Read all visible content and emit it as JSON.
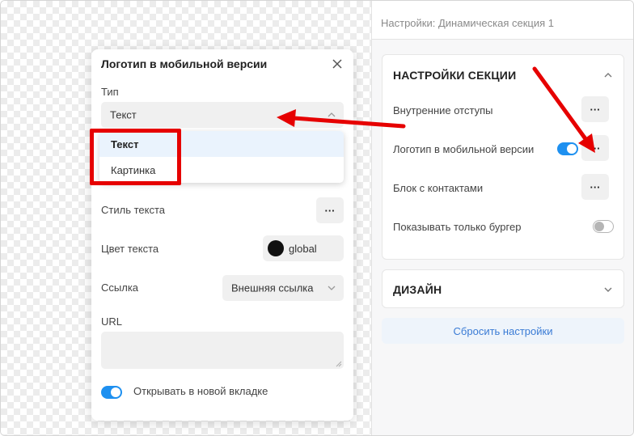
{
  "right_panel": {
    "header": "Настройки: Динамическая секция 1",
    "section_card": {
      "title": "НАСТРОЙКИ СЕКЦИИ",
      "rows": [
        {
          "label": "Внутренние отступы",
          "control": "more",
          "more_label": "···"
        },
        {
          "label": "Логотип в мобильной версии",
          "control": "toggle-more",
          "toggle": "on",
          "more_label": "···"
        },
        {
          "label": "Блок с контактами",
          "control": "more",
          "more_label": "···"
        },
        {
          "label": "Показывать только бургер",
          "control": "toggle",
          "toggle": "off"
        }
      ]
    },
    "design_card": {
      "title": "ДИЗАЙН"
    },
    "reset_button": "Сбросить настройки"
  },
  "modal": {
    "title": "Логотип в мобильной версии",
    "type_label": "Тип",
    "type_value": "Текст",
    "type_options": [
      {
        "label": "Текст",
        "selected": true
      },
      {
        "label": "Картинка",
        "selected": false
      }
    ],
    "text_style_label": "Стиль текста",
    "text_style_more": "···",
    "text_color_label": "Цвет текста",
    "text_color_value": "global",
    "text_color_swatch": "#111111",
    "link_label": "Ссылка",
    "link_value": "Внешняя ссылка",
    "url_label": "URL",
    "url_value": "",
    "new_tab_label": "Открывать в новой вкладке",
    "new_tab_enabled": true
  },
  "colors": {
    "accent_blue": "#1e90f0",
    "annotation_red": "#e60000",
    "reset_text": "#3a7bd5"
  }
}
